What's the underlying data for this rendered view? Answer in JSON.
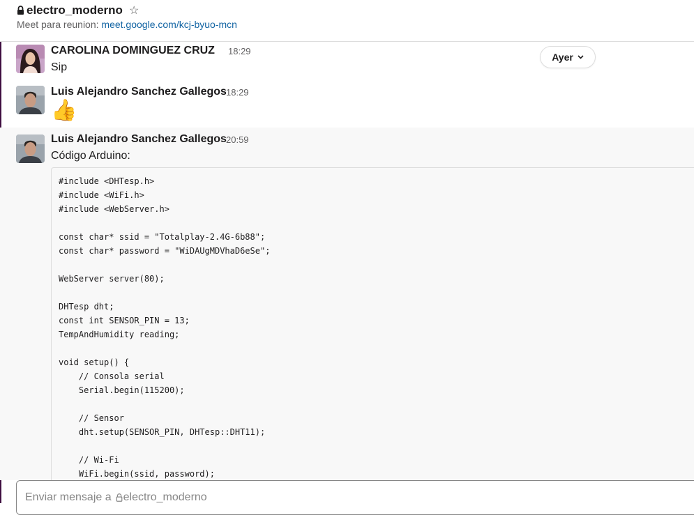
{
  "channel": {
    "name": "electro_moderno",
    "topic_prefix": "Meet para reunion:",
    "topic_link": "meet.google.com/kcj-byuo-mcn"
  },
  "date_divider": {
    "label": "Ayer"
  },
  "messages": [
    {
      "sender": "CAROLINA DOMINGUEZ CRUZ",
      "time": "18:29",
      "text": "Sip"
    },
    {
      "sender": "Luis Alejandro Sanchez Gallegos",
      "time": "18:29",
      "text": "👍"
    },
    {
      "sender": "Luis Alejandro Sanchez Gallegos",
      "time": "20:59",
      "text": "Código Arduino:"
    }
  ],
  "code": "#include <DHTesp.h>\n#include <WiFi.h>\n#include <WebServer.h>\n\nconst char* ssid = \"Totalplay-2.4G-6b88\";\nconst char* password = \"WiDAUgMDVhaD6eSe\";\n\nWebServer server(80);\n\nDHTesp dht;\nconst int SENSOR_PIN = 13;\nTempAndHumidity reading;\n\nvoid setup() {\n    // Consola serial\n    Serial.begin(115200);\n\n    // Sensor\n    dht.setup(SENSOR_PIN, DHTesp::DHT11);\n\n    // Wi-Fi\n    WiFi.begin(ssid, password);",
  "composer": {
    "placeholder_prefix": "Enviar mensaje a",
    "placeholder_channel": "electro_moderno"
  },
  "icons": [
    "lock-icon",
    "star-icon",
    "chevron-down-icon",
    "thumbs-up-emoji"
  ],
  "colors": {
    "link": "#1264a3",
    "sidebar": "#3f0e40",
    "highlight_bg": "#f8f8f8"
  }
}
